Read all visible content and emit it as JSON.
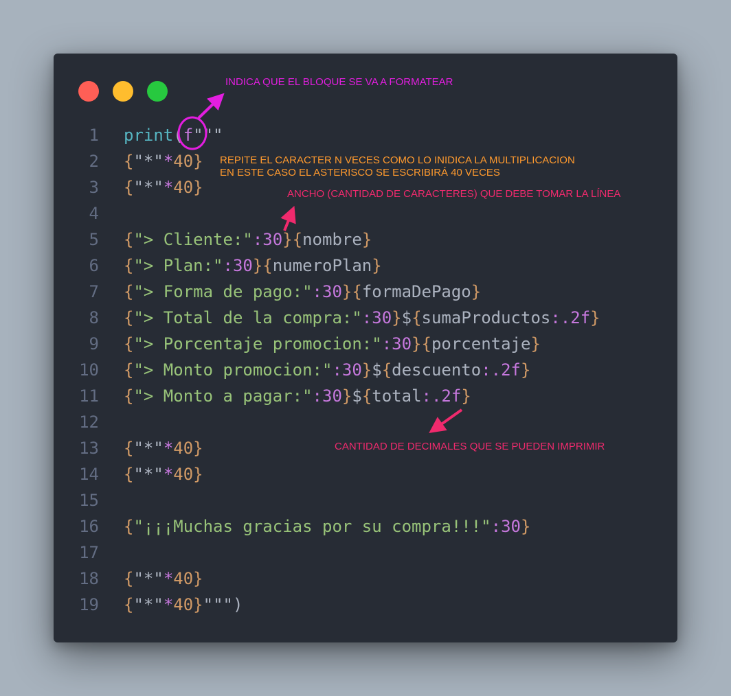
{
  "window_controls": {
    "close_color": "#ff5f56",
    "minimize_color": "#ffbd2e",
    "maximize_color": "#27c93f"
  },
  "code_lines": [
    {
      "n": "1",
      "tokens": [
        {
          "t": "print",
          "c": "k-cyan"
        },
        {
          "t": "(",
          "c": "k-plain"
        },
        {
          "t": "f",
          "c": "k-num"
        },
        {
          "t": "\"\"\"",
          "c": "k-plain"
        }
      ]
    },
    {
      "n": "2",
      "tokens": [
        {
          "t": "{",
          "c": "k-brace"
        },
        {
          "t": "\"*\"",
          "c": "k-plain"
        },
        {
          "t": "*",
          "c": "k-num"
        },
        {
          "t": "40",
          "c": "k-brace"
        },
        {
          "t": "}",
          "c": "k-brace"
        }
      ]
    },
    {
      "n": "3",
      "tokens": [
        {
          "t": "{",
          "c": "k-brace"
        },
        {
          "t": "\"*\"",
          "c": "k-plain"
        },
        {
          "t": "*",
          "c": "k-num"
        },
        {
          "t": "40",
          "c": "k-brace"
        },
        {
          "t": "}",
          "c": "k-brace"
        }
      ]
    },
    {
      "n": "4",
      "tokens": []
    },
    {
      "n": "5",
      "tokens": [
        {
          "t": "{",
          "c": "k-brace"
        },
        {
          "t": "\"> Cliente:\"",
          "c": "k-str"
        },
        {
          "t": ":30",
          "c": "k-num"
        },
        {
          "t": "}{",
          "c": "k-brace"
        },
        {
          "t": "nombre",
          "c": "k-var"
        },
        {
          "t": "}",
          "c": "k-brace"
        }
      ]
    },
    {
      "n": "6",
      "tokens": [
        {
          "t": "{",
          "c": "k-brace"
        },
        {
          "t": "\"> Plan:\"",
          "c": "k-str"
        },
        {
          "t": ":30",
          "c": "k-num"
        },
        {
          "t": "}{",
          "c": "k-brace"
        },
        {
          "t": "numeroPlan",
          "c": "k-var"
        },
        {
          "t": "}",
          "c": "k-brace"
        }
      ]
    },
    {
      "n": "7",
      "tokens": [
        {
          "t": "{",
          "c": "k-brace"
        },
        {
          "t": "\"> Forma de pago:\"",
          "c": "k-str"
        },
        {
          "t": ":30",
          "c": "k-num"
        },
        {
          "t": "}{",
          "c": "k-brace"
        },
        {
          "t": "formaDePago",
          "c": "k-var"
        },
        {
          "t": "}",
          "c": "k-brace"
        }
      ]
    },
    {
      "n": "8",
      "tokens": [
        {
          "t": "{",
          "c": "k-brace"
        },
        {
          "t": "\"> Total de la compra:\"",
          "c": "k-str"
        },
        {
          "t": ":30",
          "c": "k-num"
        },
        {
          "t": "}",
          "c": "k-brace"
        },
        {
          "t": "$",
          "c": "k-plain"
        },
        {
          "t": "{",
          "c": "k-brace"
        },
        {
          "t": "sumaProductos",
          "c": "k-var"
        },
        {
          "t": ":.2f",
          "c": "k-num"
        },
        {
          "t": "}",
          "c": "k-brace"
        }
      ]
    },
    {
      "n": "9",
      "tokens": [
        {
          "t": "{",
          "c": "k-brace"
        },
        {
          "t": "\"> Porcentaje promocion:\"",
          "c": "k-str"
        },
        {
          "t": ":30",
          "c": "k-num"
        },
        {
          "t": "}{",
          "c": "k-brace"
        },
        {
          "t": "porcentaje",
          "c": "k-var"
        },
        {
          "t": "}",
          "c": "k-brace"
        }
      ]
    },
    {
      "n": "10",
      "tokens": [
        {
          "t": "{",
          "c": "k-brace"
        },
        {
          "t": "\"> Monto promocion:\"",
          "c": "k-str"
        },
        {
          "t": ":30",
          "c": "k-num"
        },
        {
          "t": "}",
          "c": "k-brace"
        },
        {
          "t": "$",
          "c": "k-plain"
        },
        {
          "t": "{",
          "c": "k-brace"
        },
        {
          "t": "descuento",
          "c": "k-var"
        },
        {
          "t": ":.2f",
          "c": "k-num"
        },
        {
          "t": "}",
          "c": "k-brace"
        }
      ]
    },
    {
      "n": "11",
      "tokens": [
        {
          "t": "{",
          "c": "k-brace"
        },
        {
          "t": "\"> Monto a pagar:\"",
          "c": "k-str"
        },
        {
          "t": ":30",
          "c": "k-num"
        },
        {
          "t": "}",
          "c": "k-brace"
        },
        {
          "t": "$",
          "c": "k-plain"
        },
        {
          "t": "{",
          "c": "k-brace"
        },
        {
          "t": "total",
          "c": "k-var"
        },
        {
          "t": ":.2f",
          "c": "k-num"
        },
        {
          "t": "}",
          "c": "k-brace"
        }
      ]
    },
    {
      "n": "12",
      "tokens": []
    },
    {
      "n": "13",
      "tokens": [
        {
          "t": "{",
          "c": "k-brace"
        },
        {
          "t": "\"*\"",
          "c": "k-plain"
        },
        {
          "t": "*",
          "c": "k-num"
        },
        {
          "t": "40",
          "c": "k-brace"
        },
        {
          "t": "}",
          "c": "k-brace"
        }
      ]
    },
    {
      "n": "14",
      "tokens": [
        {
          "t": "{",
          "c": "k-brace"
        },
        {
          "t": "\"*\"",
          "c": "k-plain"
        },
        {
          "t": "*",
          "c": "k-num"
        },
        {
          "t": "40",
          "c": "k-brace"
        },
        {
          "t": "}",
          "c": "k-brace"
        }
      ]
    },
    {
      "n": "15",
      "tokens": []
    },
    {
      "n": "16",
      "tokens": [
        {
          "t": "{",
          "c": "k-brace"
        },
        {
          "t": "\"¡¡¡Muchas gracias por su compra!!!\"",
          "c": "k-str"
        },
        {
          "t": ":30",
          "c": "k-num"
        },
        {
          "t": "}",
          "c": "k-brace"
        }
      ]
    },
    {
      "n": "17",
      "tokens": []
    },
    {
      "n": "18",
      "tokens": [
        {
          "t": "{",
          "c": "k-brace"
        },
        {
          "t": "\"*\"",
          "c": "k-plain"
        },
        {
          "t": "*",
          "c": "k-num"
        },
        {
          "t": "40",
          "c": "k-brace"
        },
        {
          "t": "}",
          "c": "k-brace"
        }
      ]
    },
    {
      "n": "19",
      "tokens": [
        {
          "t": "{",
          "c": "k-brace"
        },
        {
          "t": "\"*\"",
          "c": "k-plain"
        },
        {
          "t": "*",
          "c": "k-num"
        },
        {
          "t": "40",
          "c": "k-brace"
        },
        {
          "t": "}",
          "c": "k-brace"
        },
        {
          "t": "\"\"\"",
          "c": "k-plain"
        },
        {
          "t": ")",
          "c": "k-plain"
        }
      ]
    }
  ],
  "annotations": {
    "format_block": "INDICA QUE EL BLOQUE SE VA A FORMATEAR",
    "repeat_line1": "REPITE EL CARACTER N VECES COMO LO INIDICA LA MULTIPLICACION",
    "repeat_line2": "EN ESTE CASO EL ASTERISCO SE ESCRIBIRÁ 40 VECES",
    "width": "ANCHO (CANTIDAD DE CARACTERES) QUE DEBE TOMAR LA LÍNEA",
    "decimals": "CANTIDAD DE DECIMALES QUE SE PUEDEN IMPRIMIR"
  },
  "colors": {
    "background": "#a7b2bd",
    "window": "#272c35",
    "annotation_magenta": "#e31ee0",
    "annotation_orange": "#ff9a2e",
    "annotation_pink": "#f02a6d"
  }
}
